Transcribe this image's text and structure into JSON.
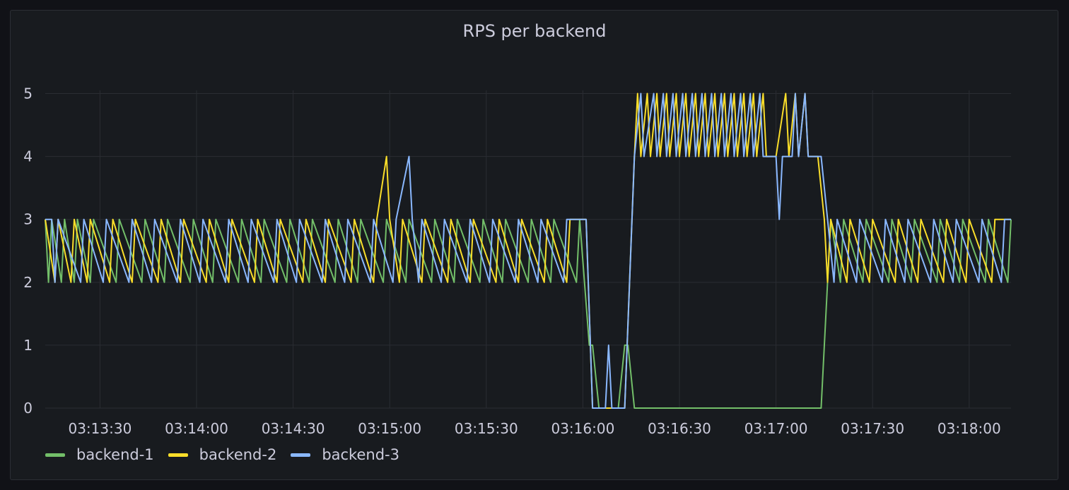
{
  "panel": {
    "title": "RPS per backend"
  },
  "chart_data": {
    "type": "line",
    "title": "RPS per backend",
    "xlabel": "",
    "ylabel": "",
    "ylim": [
      0,
      5.5
    ],
    "xlim": [
      "03:13:13",
      "03:18:13"
    ],
    "y_ticks": [
      "0",
      "1",
      "2",
      "3",
      "4",
      "5"
    ],
    "x_ticks": [
      "03:13:30",
      "03:14:00",
      "03:14:30",
      "03:15:00",
      "03:15:30",
      "03:16:00",
      "03:16:30",
      "03:17:00",
      "03:17:30",
      "03:18:00"
    ],
    "grid": true,
    "legend_position": "bottom-left",
    "series": [
      {
        "name": "backend-1",
        "color": "#73bf69",
        "description": "Oscillates between 3 and 2 until ~03:16:02, then 1 and drops to 0 by 03:16:05; brief spike to 1 near 03:16:15; stays at 0 until ~03:17:14, then returns to oscillating 3/2.",
        "points": [
          [
            "03:13:13",
            3
          ],
          [
            "03:13:14",
            2
          ],
          [
            "03:13:15",
            3
          ],
          [
            "03:13:18",
            2
          ],
          [
            "03:13:19",
            3
          ],
          [
            "03:13:22",
            2
          ],
          [
            "03:13:23",
            3
          ],
          [
            "03:13:27",
            2
          ],
          [
            "03:13:28",
            3
          ],
          [
            "03:13:35",
            2
          ],
          [
            "03:13:36",
            3
          ],
          [
            "03:13:43",
            2
          ],
          [
            "03:13:44",
            3
          ],
          [
            "03:13:50",
            2
          ],
          [
            "03:13:51",
            3
          ],
          [
            "03:13:58",
            2
          ],
          [
            "03:13:59",
            3
          ],
          [
            "03:14:05",
            2
          ],
          [
            "03:14:06",
            3
          ],
          [
            "03:14:13",
            2
          ],
          [
            "03:14:14",
            3
          ],
          [
            "03:14:20",
            2
          ],
          [
            "03:14:21",
            3
          ],
          [
            "03:14:28",
            2
          ],
          [
            "03:14:29",
            3
          ],
          [
            "03:14:35",
            2
          ],
          [
            "03:14:36",
            3
          ],
          [
            "03:14:43",
            2
          ],
          [
            "03:14:44",
            3
          ],
          [
            "03:14:50",
            2
          ],
          [
            "03:14:51",
            3
          ],
          [
            "03:14:58",
            2
          ],
          [
            "03:14:59",
            3
          ],
          [
            "03:15:05",
            2
          ],
          [
            "03:15:06",
            3
          ],
          [
            "03:15:13",
            2
          ],
          [
            "03:15:14",
            3
          ],
          [
            "03:15:20",
            2
          ],
          [
            "03:15:21",
            3
          ],
          [
            "03:15:28",
            2
          ],
          [
            "03:15:29",
            3
          ],
          [
            "03:15:35",
            2
          ],
          [
            "03:15:36",
            3
          ],
          [
            "03:15:43",
            2
          ],
          [
            "03:15:44",
            3
          ],
          [
            "03:15:50",
            2
          ],
          [
            "03:15:51",
            3
          ],
          [
            "03:15:58",
            2
          ],
          [
            "03:15:59",
            3
          ],
          [
            "03:16:02",
            1
          ],
          [
            "03:16:03",
            1
          ],
          [
            "03:16:05",
            0
          ],
          [
            "03:16:11",
            0
          ],
          [
            "03:16:13",
            1
          ],
          [
            "03:16:14",
            1
          ],
          [
            "03:16:16",
            0
          ],
          [
            "03:17:14",
            0
          ],
          [
            "03:17:16",
            2
          ],
          [
            "03:17:17",
            3
          ],
          [
            "03:17:20",
            2
          ],
          [
            "03:17:21",
            3
          ],
          [
            "03:17:27",
            2
          ],
          [
            "03:17:28",
            3
          ],
          [
            "03:17:35",
            2
          ],
          [
            "03:17:36",
            3
          ],
          [
            "03:17:42",
            2
          ],
          [
            "03:17:43",
            3
          ],
          [
            "03:17:50",
            2
          ],
          [
            "03:17:51",
            3
          ],
          [
            "03:17:57",
            2
          ],
          [
            "03:17:58",
            3
          ],
          [
            "03:18:05",
            2
          ],
          [
            "03:18:06",
            3
          ],
          [
            "03:18:12",
            2
          ],
          [
            "03:18:13",
            3
          ]
        ]
      },
      {
        "name": "backend-2",
        "color": "#fade2a",
        "description": "Oscillates between 3 and 2 with a spike to 4 near 03:14:59; drops to 0 at ~03:16:03, rises to ~4 by 03:16:16, oscillates between 5 and 4 until ~03:17:13, then back to 3/2 oscillation.",
        "points": [
          [
            "03:13:13",
            3
          ],
          [
            "03:13:16",
            2
          ],
          [
            "03:13:17",
            3
          ],
          [
            "03:13:21",
            2
          ],
          [
            "03:13:22",
            3
          ],
          [
            "03:13:26",
            2
          ],
          [
            "03:13:27",
            3
          ],
          [
            "03:13:33",
            2
          ],
          [
            "03:13:34",
            3
          ],
          [
            "03:13:40",
            2
          ],
          [
            "03:13:41",
            3
          ],
          [
            "03:13:48",
            2
          ],
          [
            "03:13:49",
            3
          ],
          [
            "03:13:55",
            2
          ],
          [
            "03:13:56",
            3
          ],
          [
            "03:14:03",
            2
          ],
          [
            "03:14:04",
            3
          ],
          [
            "03:14:10",
            2
          ],
          [
            "03:14:11",
            3
          ],
          [
            "03:14:18",
            2
          ],
          [
            "03:14:19",
            3
          ],
          [
            "03:14:25",
            2
          ],
          [
            "03:14:26",
            3
          ],
          [
            "03:14:33",
            2
          ],
          [
            "03:14:34",
            3
          ],
          [
            "03:14:40",
            2
          ],
          [
            "03:14:41",
            3
          ],
          [
            "03:14:48",
            2
          ],
          [
            "03:14:49",
            3
          ],
          [
            "03:14:55",
            2
          ],
          [
            "03:14:56",
            3
          ],
          [
            "03:14:59",
            4
          ],
          [
            "03:15:00",
            3
          ],
          [
            "03:15:03",
            2
          ],
          [
            "03:15:04",
            3
          ],
          [
            "03:15:10",
            2
          ],
          [
            "03:15:11",
            3
          ],
          [
            "03:15:18",
            2
          ],
          [
            "03:15:19",
            3
          ],
          [
            "03:15:25",
            2
          ],
          [
            "03:15:26",
            3
          ],
          [
            "03:15:33",
            2
          ],
          [
            "03:15:34",
            3
          ],
          [
            "03:15:40",
            2
          ],
          [
            "03:15:41",
            3
          ],
          [
            "03:15:48",
            2
          ],
          [
            "03:15:49",
            3
          ],
          [
            "03:15:55",
            2
          ],
          [
            "03:15:56",
            3
          ],
          [
            "03:16:01",
            3
          ],
          [
            "03:16:03",
            0
          ],
          [
            "03:16:13",
            0
          ],
          [
            "03:16:16",
            4
          ],
          [
            "03:16:17",
            5
          ],
          [
            "03:16:18",
            4
          ],
          [
            "03:16:20",
            5
          ],
          [
            "03:16:21",
            4
          ],
          [
            "03:16:23",
            5
          ],
          [
            "03:16:24",
            4
          ],
          [
            "03:16:26",
            5
          ],
          [
            "03:16:27",
            4
          ],
          [
            "03:16:29",
            5
          ],
          [
            "03:16:30",
            4
          ],
          [
            "03:16:32",
            5
          ],
          [
            "03:16:33",
            4
          ],
          [
            "03:16:35",
            5
          ],
          [
            "03:16:36",
            4
          ],
          [
            "03:16:38",
            5
          ],
          [
            "03:16:39",
            4
          ],
          [
            "03:16:41",
            5
          ],
          [
            "03:16:42",
            4
          ],
          [
            "03:16:44",
            5
          ],
          [
            "03:16:45",
            4
          ],
          [
            "03:16:47",
            5
          ],
          [
            "03:16:48",
            4
          ],
          [
            "03:16:50",
            5
          ],
          [
            "03:16:51",
            4
          ],
          [
            "03:16:53",
            5
          ],
          [
            "03:16:54",
            4
          ],
          [
            "03:16:56",
            5
          ],
          [
            "03:16:57",
            4
          ],
          [
            "03:17:00",
            4
          ],
          [
            "03:17:03",
            5
          ],
          [
            "03:17:04",
            4
          ],
          [
            "03:17:06",
            5
          ],
          [
            "03:17:07",
            4
          ],
          [
            "03:17:09",
            5
          ],
          [
            "03:17:10",
            4
          ],
          [
            "03:17:13",
            4
          ],
          [
            "03:17:15",
            3
          ],
          [
            "03:17:16",
            2
          ],
          [
            "03:17:17",
            3
          ],
          [
            "03:17:22",
            2
          ],
          [
            "03:17:23",
            3
          ],
          [
            "03:17:29",
            2
          ],
          [
            "03:17:30",
            3
          ],
          [
            "03:17:37",
            2
          ],
          [
            "03:17:38",
            3
          ],
          [
            "03:17:44",
            2
          ],
          [
            "03:17:45",
            3
          ],
          [
            "03:17:52",
            2
          ],
          [
            "03:17:53",
            3
          ],
          [
            "03:17:59",
            2
          ],
          [
            "03:18:00",
            3
          ],
          [
            "03:18:07",
            2
          ],
          [
            "03:18:08",
            3
          ],
          [
            "03:18:13",
            3
          ]
        ]
      },
      {
        "name": "backend-3",
        "color": "#8ab8ff",
        "description": "Oscillates between 3 and 2 with a spike to 4 near 03:15:06; drops to 0 at ~03:16:03 with a brief spike to 1 near 03:16:08; rises to 4 by 03:16:16, oscillates 5/4 with a dip to 3 near 03:17:01; returns to 3/2 oscillation after ~03:17:15.",
        "points": [
          [
            "03:13:13",
            3
          ],
          [
            "03:13:15",
            3
          ],
          [
            "03:13:16",
            2
          ],
          [
            "03:13:17",
            3
          ],
          [
            "03:13:24",
            2
          ],
          [
            "03:13:25",
            3
          ],
          [
            "03:13:31",
            2
          ],
          [
            "03:13:32",
            3
          ],
          [
            "03:13:39",
            2
          ],
          [
            "03:13:40",
            3
          ],
          [
            "03:13:46",
            2
          ],
          [
            "03:13:47",
            3
          ],
          [
            "03:13:54",
            2
          ],
          [
            "03:13:55",
            3
          ],
          [
            "03:14:01",
            2
          ],
          [
            "03:14:02",
            3
          ],
          [
            "03:14:09",
            2
          ],
          [
            "03:14:10",
            3
          ],
          [
            "03:14:16",
            2
          ],
          [
            "03:14:17",
            3
          ],
          [
            "03:14:24",
            2
          ],
          [
            "03:14:25",
            3
          ],
          [
            "03:14:31",
            2
          ],
          [
            "03:14:32",
            3
          ],
          [
            "03:14:39",
            2
          ],
          [
            "03:14:40",
            3
          ],
          [
            "03:14:46",
            2
          ],
          [
            "03:14:47",
            3
          ],
          [
            "03:14:54",
            2
          ],
          [
            "03:14:55",
            3
          ],
          [
            "03:15:01",
            2
          ],
          [
            "03:15:02",
            3
          ],
          [
            "03:15:06",
            4
          ],
          [
            "03:15:07",
            3
          ],
          [
            "03:15:09",
            2
          ],
          [
            "03:15:10",
            3
          ],
          [
            "03:15:16",
            2
          ],
          [
            "03:15:17",
            3
          ],
          [
            "03:15:24",
            2
          ],
          [
            "03:15:25",
            3
          ],
          [
            "03:15:31",
            2
          ],
          [
            "03:15:32",
            3
          ],
          [
            "03:15:39",
            2
          ],
          [
            "03:15:40",
            3
          ],
          [
            "03:15:46",
            2
          ],
          [
            "03:15:47",
            3
          ],
          [
            "03:15:54",
            2
          ],
          [
            "03:15:55",
            3
          ],
          [
            "03:16:01",
            3
          ],
          [
            "03:16:03",
            0
          ],
          [
            "03:16:07",
            0
          ],
          [
            "03:16:08",
            1
          ],
          [
            "03:16:09",
            0
          ],
          [
            "03:16:13",
            0
          ],
          [
            "03:16:16",
            4
          ],
          [
            "03:16:18",
            5
          ],
          [
            "03:16:19",
            4
          ],
          [
            "03:16:22",
            5
          ],
          [
            "03:16:23",
            4
          ],
          [
            "03:16:25",
            5
          ],
          [
            "03:16:26",
            4
          ],
          [
            "03:16:28",
            5
          ],
          [
            "03:16:29",
            4
          ],
          [
            "03:16:31",
            5
          ],
          [
            "03:16:32",
            4
          ],
          [
            "03:16:34",
            5
          ],
          [
            "03:16:35",
            4
          ],
          [
            "03:16:37",
            5
          ],
          [
            "03:16:38",
            4
          ],
          [
            "03:16:40",
            5
          ],
          [
            "03:16:41",
            4
          ],
          [
            "03:16:43",
            5
          ],
          [
            "03:16:44",
            4
          ],
          [
            "03:16:46",
            5
          ],
          [
            "03:16:47",
            4
          ],
          [
            "03:16:49",
            5
          ],
          [
            "03:16:50",
            4
          ],
          [
            "03:16:52",
            5
          ],
          [
            "03:16:53",
            4
          ],
          [
            "03:16:55",
            5
          ],
          [
            "03:16:56",
            4
          ],
          [
            "03:17:00",
            4
          ],
          [
            "03:17:01",
            3
          ],
          [
            "03:17:02",
            4
          ],
          [
            "03:17:05",
            4
          ],
          [
            "03:17:06",
            5
          ],
          [
            "03:17:07",
            4
          ],
          [
            "03:17:09",
            5
          ],
          [
            "03:17:10",
            4
          ],
          [
            "03:17:14",
            4
          ],
          [
            "03:17:16",
            3
          ],
          [
            "03:17:18",
            2
          ],
          [
            "03:17:19",
            3
          ],
          [
            "03:17:25",
            2
          ],
          [
            "03:17:26",
            3
          ],
          [
            "03:17:33",
            2
          ],
          [
            "03:17:34",
            3
          ],
          [
            "03:17:40",
            2
          ],
          [
            "03:17:41",
            3
          ],
          [
            "03:17:48",
            2
          ],
          [
            "03:17:49",
            3
          ],
          [
            "03:17:55",
            2
          ],
          [
            "03:17:56",
            3
          ],
          [
            "03:18:03",
            2
          ],
          [
            "03:18:04",
            3
          ],
          [
            "03:18:10",
            2
          ],
          [
            "03:18:11",
            3
          ],
          [
            "03:18:13",
            3
          ]
        ]
      }
    ]
  }
}
